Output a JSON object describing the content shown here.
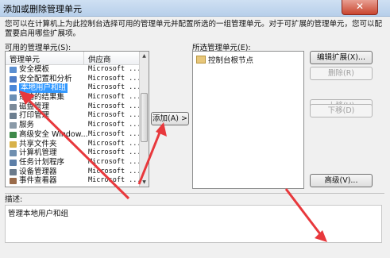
{
  "window": {
    "title": "添加或删除管理单元",
    "close_glyph": "✕"
  },
  "instruction": "您可以在计算机上为此控制台选择可用的管理单元并配置所选的一组管理单元。对于可扩展的管理单元，您可以配置要启用哪些扩展项。",
  "available": {
    "label": "可用的管理单元(S):",
    "col_name": "管理单元",
    "col_vendor": "供应商",
    "rows": [
      {
        "name": "安全模板",
        "vendor": "Microsoft ...",
        "icon_color": "#5b8fd1"
      },
      {
        "name": "安全配置和分析",
        "vendor": "Microsoft ...",
        "icon_color": "#4f7ec7"
      },
      {
        "name": "本地用户和组",
        "vendor": "Microsoft ...",
        "icon_color": "#4a87d8"
      },
      {
        "name": "策略的结果集",
        "vendor": "Microsoft ...",
        "icon_color": "#6a8fb5"
      },
      {
        "name": "磁盘管理",
        "vendor": "Microsoft ...",
        "icon_color": "#7b8a99"
      },
      {
        "name": "打印管理",
        "vendor": "Microsoft ...",
        "icon_color": "#6d7f90"
      },
      {
        "name": "服务",
        "vendor": "Microsoft ...",
        "icon_color": "#8a9aa8"
      },
      {
        "name": "高级安全 Window...",
        "vendor": "Microsoft ...",
        "icon_color": "#3f8a4a"
      },
      {
        "name": "共享文件夹",
        "vendor": "Microsoft ...",
        "icon_color": "#d8b24a"
      },
      {
        "name": "计算机管理",
        "vendor": "Microsoft ...",
        "icon_color": "#6f8fb0"
      },
      {
        "name": "任务计划程序",
        "vendor": "Microsoft ...",
        "icon_color": "#5d7fa8"
      },
      {
        "name": "设备管理器",
        "vendor": "Microsoft ...",
        "icon_color": "#6b7b8c"
      },
      {
        "name": "事件查看器",
        "vendor": "Microsoft ...",
        "icon_color": "#9a6b4a"
      }
    ],
    "scroll_up": "▲",
    "scroll_down": "▼"
  },
  "add_button": "添加(A) >",
  "selected": {
    "label": "所选管理单元(E):",
    "root": "控制台根节点"
  },
  "side_buttons": {
    "edit_ext": "编辑扩展(X)...",
    "remove": "删除(R)",
    "move_up": "上移(U)",
    "move_down": "下移(D)",
    "advanced": "高级(V)..."
  },
  "description": {
    "label": "描述:",
    "text": "管理本地用户和组"
  },
  "colors": {
    "selection": "#3399ff",
    "arrow": "#e8383c",
    "titlebar": "#c4d8ef"
  }
}
